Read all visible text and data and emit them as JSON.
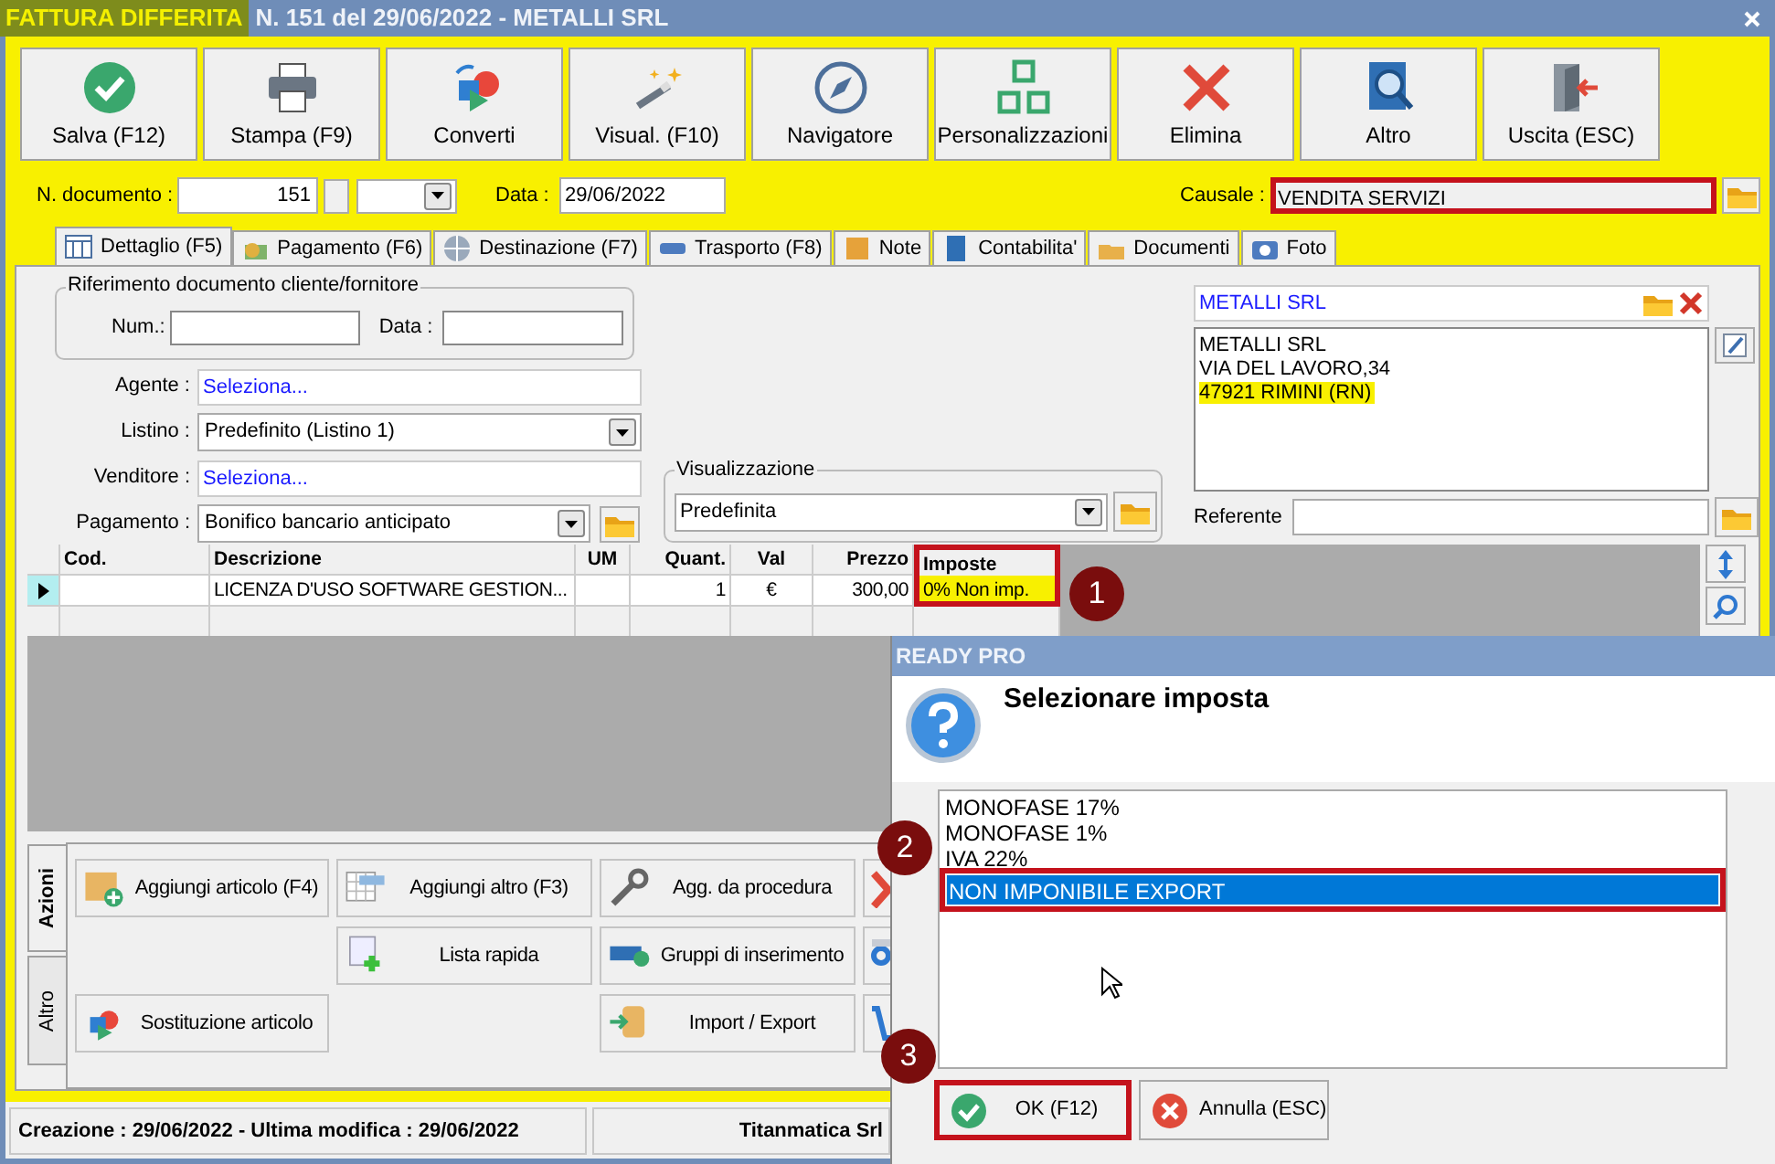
{
  "window": {
    "title_highlight": "FATTURA DIFFERITA",
    "title": "N. 151 del 29/06/2022 - METALLI SRL"
  },
  "toolbar": [
    {
      "label": "Salva (F12)"
    },
    {
      "label": "Stampa (F9)"
    },
    {
      "label": "Converti"
    },
    {
      "label": "Visual. (F10)"
    },
    {
      "label": "Navigatore"
    },
    {
      "label": "Personalizzazioni"
    },
    {
      "label": "Elimina"
    },
    {
      "label": "Altro"
    },
    {
      "label": "Uscita (ESC)"
    }
  ],
  "document": {
    "number_label": "N. documento :",
    "number": "151",
    "date_label": "Data :",
    "date": "29/06/2022",
    "causale_label": "Causale :",
    "causale": "VENDITA SERVIZI",
    "causale_highlighted": true
  },
  "tabs": [
    {
      "label": "Dettaglio (F5)",
      "selected": true
    },
    {
      "label": "Pagamento (F6)",
      "selected": false
    },
    {
      "label": "Destinazione (F7)",
      "selected": false
    },
    {
      "label": "Trasporto (F8)",
      "selected": false
    },
    {
      "label": "Note",
      "selected": false
    },
    {
      "label": "Contabilita'",
      "selected": false
    },
    {
      "label": "Documenti",
      "selected": false
    },
    {
      "label": "Foto",
      "selected": false
    }
  ],
  "reference_group": {
    "title": "Riferimento documento cliente/fornitore",
    "num_label": "Num.:",
    "date_label": "Data :"
  },
  "fields": [
    {
      "label": "Agente :",
      "value": "Seleziona...",
      "kind": "link"
    },
    {
      "label": "Listino :",
      "value": "Predefinito (Listino 1)",
      "kind": "select"
    },
    {
      "label": "Venditore :",
      "value": "Seleziona...",
      "kind": "link"
    },
    {
      "label": "Pagamento :",
      "value": "Bonifico bancario anticipato",
      "kind": "select_folder"
    }
  ],
  "view_group": {
    "title": "Visualizzazione",
    "value": "Predefinita"
  },
  "customer": {
    "name": "METALLI SRL",
    "address": [
      {
        "text": "METALLI SRL",
        "highlighted": false
      },
      {
        "text": "VIA DEL LAVORO,34",
        "highlighted": false
      },
      {
        "text": "47921 RIMINI (RN)",
        "highlighted": true
      }
    ],
    "referente_label": "Referente"
  },
  "grid": {
    "columns": [
      {
        "label": "Cod.",
        "highlighted": false
      },
      {
        "label": "Descrizione",
        "highlighted": false
      },
      {
        "label": "UM",
        "highlighted": false
      },
      {
        "label": "Quant.",
        "highlighted": false
      },
      {
        "label": "Val",
        "highlighted": false
      },
      {
        "label": "Prezzo",
        "highlighted": false
      },
      {
        "label": "Imposte",
        "highlighted": true
      }
    ],
    "rows": [
      {
        "selected": true,
        "cells": [
          null,
          "LICENZA D'USO SOFTWARE GESTION...",
          null,
          "1",
          "€",
          "300,00",
          "0% Non imp."
        ]
      }
    ]
  },
  "actions": {
    "tabs": [
      {
        "label": "Azioni",
        "selected": true
      },
      {
        "label": "Altro",
        "selected": false
      }
    ],
    "buttons": [
      {
        "label": "Aggiungi articolo (F4)"
      },
      {
        "label": "Aggiungi altro (F3)"
      },
      {
        "label": "Agg. da procedura"
      },
      {
        "label": "Lista rapida"
      },
      {
        "label": "Gruppi di inserimento"
      },
      {
        "label": "Sostituzione articolo"
      },
      {
        "label": "Import / Export"
      }
    ]
  },
  "status_bar": {
    "left": "Creazione : 29/06/2022 - Ultima modifica : 29/06/2022",
    "right": "Titanmatica Srl"
  },
  "dialog": {
    "title": "READY PRO",
    "heading": "Selezionare imposta",
    "items": [
      {
        "label": "MONOFASE 17%",
        "selected": false,
        "highlighted": false
      },
      {
        "label": "MONOFASE 1%",
        "selected": false,
        "highlighted": false
      },
      {
        "label": "IVA 22%",
        "selected": false,
        "highlighted": false
      },
      {
        "label": "NON IMPONIBILE EXPORT",
        "selected": true,
        "highlighted": true
      }
    ],
    "buttons": [
      {
        "label": "OK (F12)",
        "kind": "ok",
        "highlighted": true
      },
      {
        "label": "Annulla (ESC)",
        "kind": "cancel",
        "highlighted": false
      }
    ]
  },
  "annotations": [
    {
      "label": "1"
    },
    {
      "label": "2"
    },
    {
      "label": "3"
    }
  ]
}
